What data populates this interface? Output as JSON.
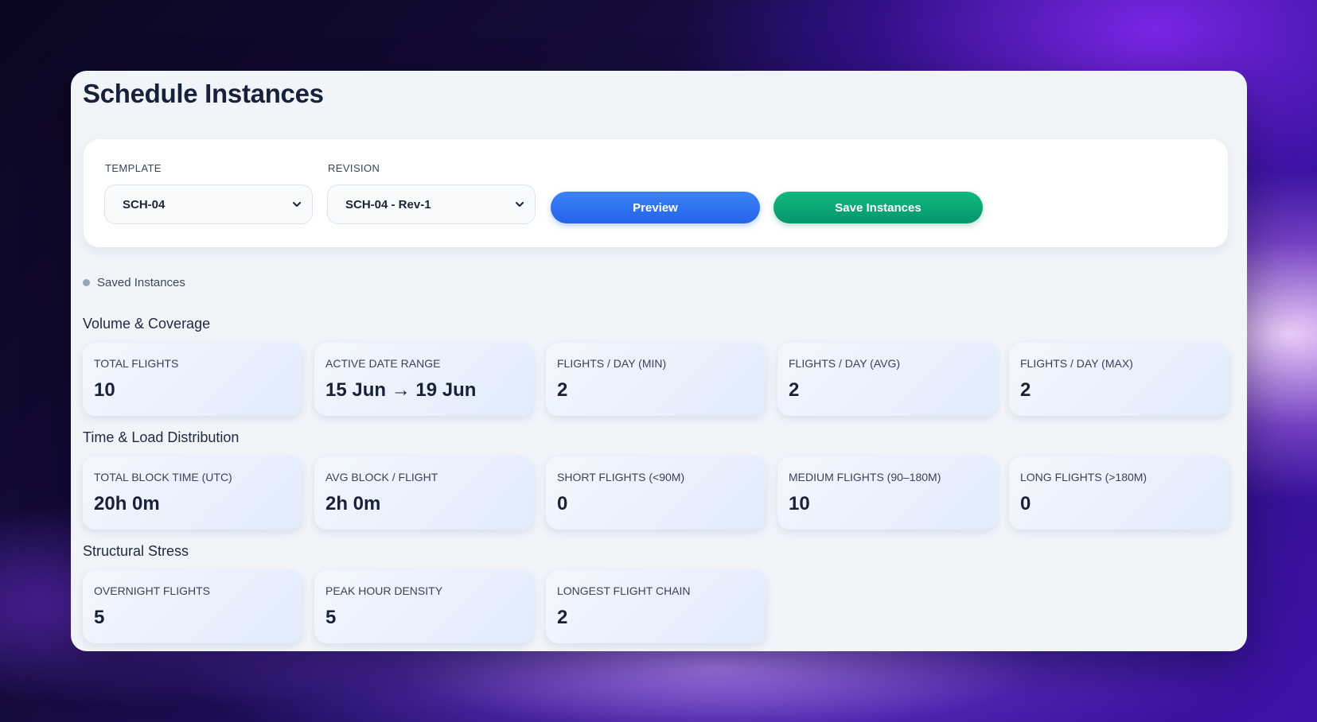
{
  "page": {
    "title": "Schedule Instances"
  },
  "controls": {
    "template": {
      "label": "TEMPLATE",
      "value": "SCH-04"
    },
    "revision": {
      "label": "REVISION",
      "value": "SCH-04 - Rev-1"
    },
    "preview_label": "Preview",
    "save_label": "Save Instances",
    "icons": [
      "chevron-down-icon"
    ]
  },
  "status": {
    "text": "Saved Instances"
  },
  "sections": [
    {
      "title": "Volume & Coverage",
      "metrics": [
        {
          "label": "TOTAL FLIGHTS",
          "value": "10"
        },
        {
          "label": "ACTIVE DATE RANGE",
          "value": "15 Jun → 19 Jun"
        },
        {
          "label": "FLIGHTS / DAY (MIN)",
          "value": "2"
        },
        {
          "label": "FLIGHTS / DAY (AVG)",
          "value": "2"
        },
        {
          "label": "FLIGHTS / DAY (MAX)",
          "value": "2"
        }
      ]
    },
    {
      "title": "Time & Load Distribution",
      "metrics": [
        {
          "label": "TOTAL BLOCK TIME (UTC)",
          "value": "20h 0m"
        },
        {
          "label": "AVG BLOCK / FLIGHT",
          "value": "2h 0m"
        },
        {
          "label": "SHORT FLIGHTS (<90M)",
          "value": "0"
        },
        {
          "label": "MEDIUM FLIGHTS (90–180M)",
          "value": "10"
        },
        {
          "label": "LONG FLIGHTS (>180M)",
          "value": "0"
        }
      ]
    },
    {
      "title": "Structural Stress",
      "metrics": [
        {
          "label": "OVERNIGHT FLIGHTS",
          "value": "5"
        },
        {
          "label": "PEAK HOUR DENSITY",
          "value": "5"
        },
        {
          "label": "LONGEST FLIGHT CHAIN",
          "value": "2"
        }
      ]
    }
  ],
  "colors": {
    "preview_button": "#2563eb",
    "save_button": "#059669",
    "status_dot": "#9aa3b4",
    "window_background": "#f1f4f9"
  }
}
